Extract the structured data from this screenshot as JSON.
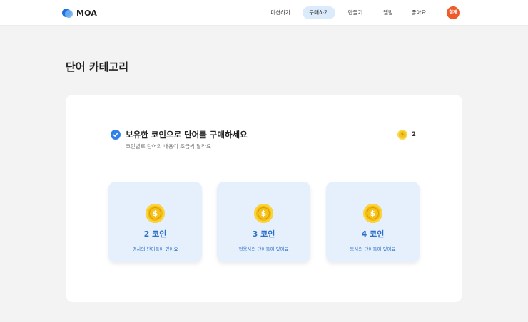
{
  "app": {
    "logo_text": "MOA"
  },
  "nav": {
    "items": [
      {
        "label": "미션하기"
      },
      {
        "label": "구매하기"
      },
      {
        "label": "만들기"
      },
      {
        "label": "앨범"
      },
      {
        "label": "좋아요"
      }
    ],
    "active_index": 1,
    "avatar_text": "철재"
  },
  "page": {
    "title": "단어 카테고리"
  },
  "panel": {
    "headline": "보유한 코인으로 단어를 구매하세요",
    "subline": "코인별로 단어의 내용이 조금씩 달라요",
    "balance": "2"
  },
  "cards": [
    {
      "coin_symbol": "$",
      "label": "2 코인",
      "desc": "명사의 단어들이 있어요"
    },
    {
      "coin_symbol": "$",
      "label": "3 코인",
      "desc": "형용사의 단어들이 있어요"
    },
    {
      "coin_symbol": "$",
      "label": "4 코인",
      "desc": "동사의 단어들이 있어요"
    }
  ],
  "colors": {
    "accent": "#2f80e8",
    "card_bg": "#e6f0fc",
    "coin": "#f2b90f",
    "avatar": "#ef5a2a",
    "nav_active": "#dcebfb"
  },
  "icons": {
    "logo": "moa-logo-icon",
    "check": "check-circle-icon",
    "coin": "dollar-coin-icon"
  }
}
